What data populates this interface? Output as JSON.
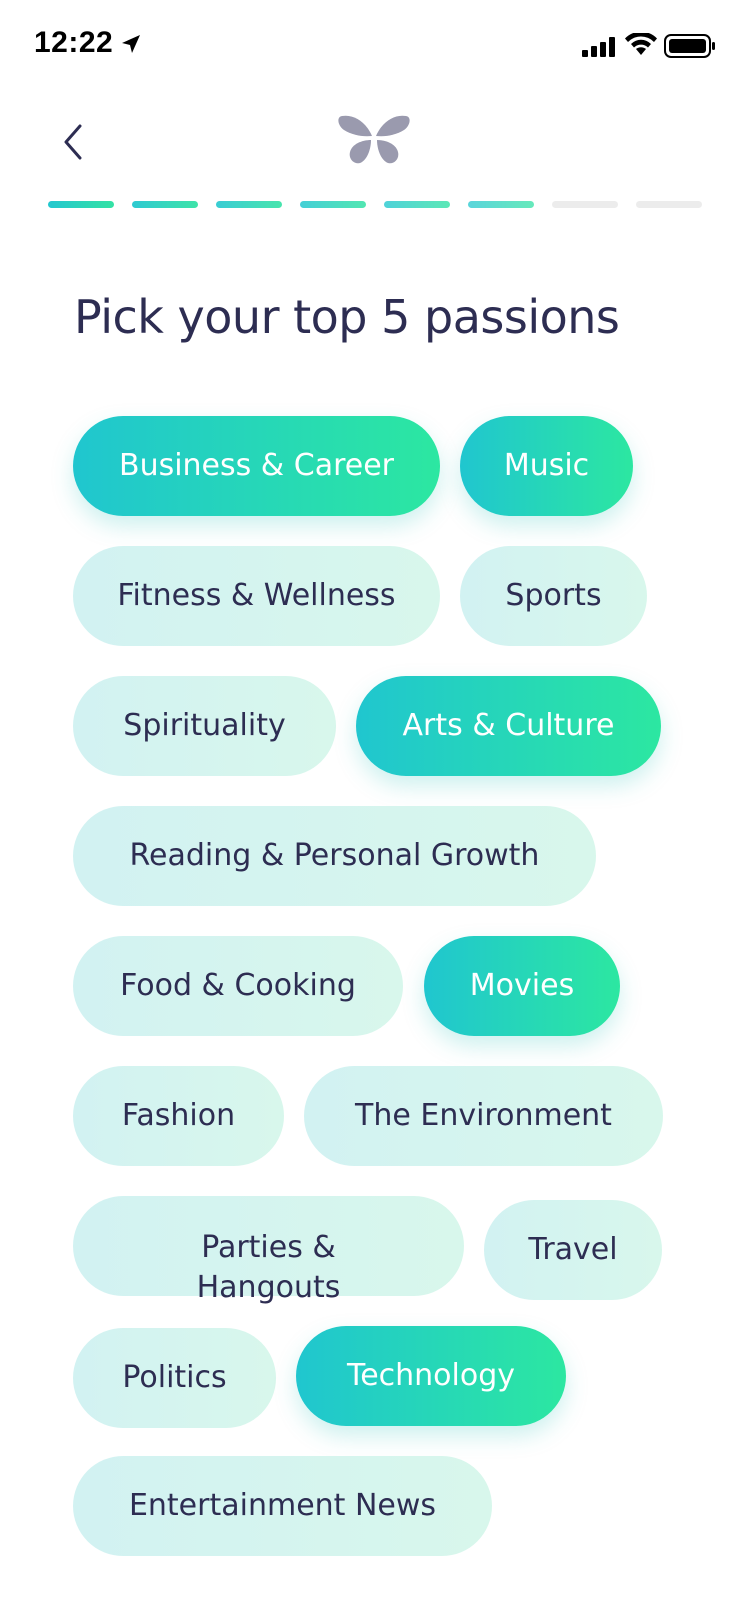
{
  "status_bar": {
    "time": "12:22"
  },
  "header": {
    "back_icon": "chevron-left-icon",
    "logo_icon": "butterfly-logo-icon"
  },
  "progress": {
    "total_steps": 8,
    "completed_steps": 6,
    "active_color_start": "#23c7cf",
    "active_color_end": "#34e2a4",
    "inactive_color": "#ececec"
  },
  "title": "Pick your top 5 passions",
  "passions": [
    {
      "label": "Business & Career",
      "selected": true
    },
    {
      "label": "Music",
      "selected": true
    },
    {
      "label": "Fitness & Wellness",
      "selected": false
    },
    {
      "label": "Sports",
      "selected": false
    },
    {
      "label": "Spirituality",
      "selected": false
    },
    {
      "label": "Arts & Culture",
      "selected": true
    },
    {
      "label": "Reading & Personal Growth",
      "selected": false
    },
    {
      "label": "Food & Cooking",
      "selected": false
    },
    {
      "label": "Movies",
      "selected": true
    },
    {
      "label": "Fashion",
      "selected": false
    },
    {
      "label": "The Environment",
      "selected": false
    },
    {
      "label": "Parties & Hangouts",
      "selected": false
    },
    {
      "label": "Travel",
      "selected": false
    },
    {
      "label": "Politics",
      "selected": false
    },
    {
      "label": "Technology",
      "selected": true
    },
    {
      "label": "Entertainment News",
      "selected": false
    }
  ],
  "colors": {
    "title_text": "#2d2d52",
    "chip_unselected_bg": "#d4f4f0",
    "chip_selected_start": "#20c6cf",
    "chip_selected_end": "#2ce7a1",
    "logo": "#9a9aae"
  }
}
